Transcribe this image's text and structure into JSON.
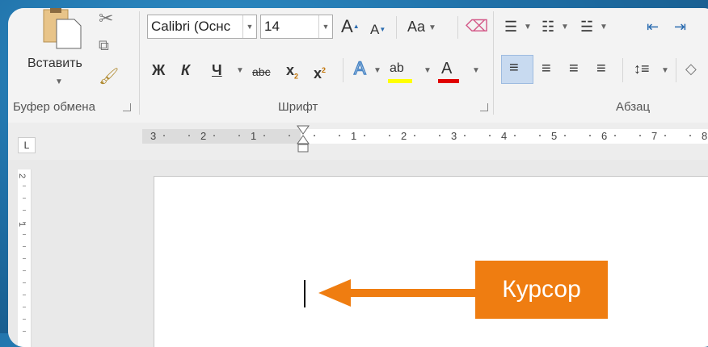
{
  "clipboard": {
    "paste_label": "Вставить",
    "group_label": "Буфер обмена"
  },
  "font": {
    "font_name": "Calibri (Оснс",
    "font_size": "14",
    "grow_glyph": "A",
    "shrink_glyph": "A",
    "case_glyph": "Aa",
    "bold": "Ж",
    "italic": "К",
    "underline": "Ч",
    "strike": "abc",
    "subscript": "x",
    "subscript_mark": "2",
    "superscript": "x",
    "superscript_mark": "2",
    "text_effects": "A",
    "highlight": "ab",
    "font_color": "A",
    "group_label": "Шрифт"
  },
  "paragraph": {
    "group_label": "Абзац"
  },
  "ruler": {
    "corner_glyph": "L",
    "left_numbers": [
      "3",
      "2",
      "1"
    ],
    "right_numbers": [
      "1",
      "2",
      "3",
      "4",
      "5",
      "6",
      "7",
      "8"
    ],
    "vertical_numbers": [
      "2",
      "1"
    ]
  },
  "callout": {
    "label": "Курсор",
    "color": "#ef7d11"
  },
  "colors": {
    "highlight_yellow": "#ffff00",
    "font_red": "#e00000",
    "text_effect_blue": "#4a86c5",
    "active_align_bg": "#c8daf0"
  }
}
